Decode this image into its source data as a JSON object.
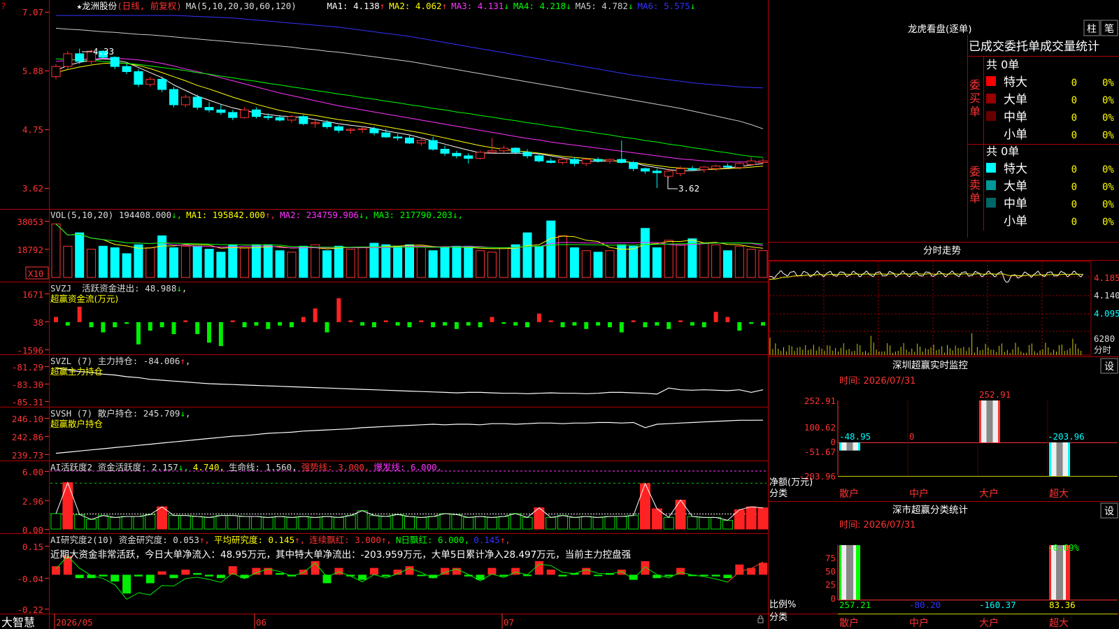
{
  "app": {
    "brand": "大智慧"
  },
  "main_chart": {
    "star": "★",
    "stock_name": "龙洲股份",
    "period": "(日线, 前复权)",
    "ma_params": "MA(5,10,20,30,60,120)",
    "ma_items": [
      {
        "label": "MA1: 4.138",
        "arrow": "↑",
        "color": "#ffffff"
      },
      {
        "label": "MA2: 4.062",
        "arrow": "↑",
        "color": "#ffff00"
      },
      {
        "label": "MA3: 4.131",
        "arrow": "↓",
        "color": "#ff33ff"
      },
      {
        "label": "MA4: 4.218",
        "arrow": "↓",
        "color": "#00ff00"
      },
      {
        "label": "MA5: 4.782",
        "arrow": "↓",
        "color": "#cccccc"
      },
      {
        "label": "MA6: 5.575",
        "arrow": "↓",
        "color": "#3333ff"
      }
    ],
    "y_ticks": [
      "7.07",
      "5.88",
      "4.75",
      "3.62"
    ],
    "high_label": "4.33",
    "low_label": "3.62"
  },
  "vol_panel": {
    "header": [
      {
        "text": "VOL(5,10,20) 194408.000",
        "arrow": "↓",
        "color": "#dddddd"
      },
      {
        "text": "MA1: 195842.000",
        "arrow": "↑",
        "color": "#ffff00"
      },
      {
        "text": "MA2: 234759.906",
        "arrow": "↓",
        "color": "#ff33ff"
      },
      {
        "text": "MA3: 217790.203",
        "arrow": "↓",
        "color": "#00ff00"
      }
    ],
    "y_ticks": [
      "38053",
      "18792"
    ],
    "unit": "X10"
  },
  "svzj_panel": {
    "title": "SVZJ  活跃资金进出: 48.988",
    "arrow": "↓",
    "subtitle": "超赢资金流(万元)",
    "y_ticks": [
      "1671",
      "38",
      "-1596"
    ]
  },
  "svzl_panel": {
    "title": "SVZL (7) 主力持仓: -84.006",
    "arrow": "↑",
    "subtitle": "超赢主力持仓",
    "y_ticks": [
      "-81.29",
      "-83.30",
      "-85.31"
    ]
  },
  "svsh_panel": {
    "title": "SVSH (7) 散户持仓: 245.709",
    "arrow": "↓",
    "subtitle": "超赢散户持仓",
    "y_ticks": [
      "246.10",
      "242.86",
      "239.73"
    ]
  },
  "ai_active_panel": {
    "header": [
      {
        "text": "AI活跃度2 资金活跃度: 2.157",
        "arrow": "↓",
        "color": "#dddddd"
      },
      {
        "text": "4.740,",
        "arrow": "",
        "color": "#ffff00"
      },
      {
        "text": "生命线: 1.560,",
        "arrow": "",
        "color": "#dddddd"
      },
      {
        "text": "强势线: 3.000,",
        "arrow": "",
        "color": "#ff3333"
      },
      {
        "text": "爆发线: 6.000,",
        "arrow": "",
        "color": "#ff33ff"
      }
    ],
    "y_ticks": [
      "6.00",
      "2.96",
      "0.00"
    ]
  },
  "ai_research_panel": {
    "header": [
      {
        "text": "AI研究度2(10) 资金研究度: 0.053",
        "arrow": "↑",
        "color": "#dddddd"
      },
      {
        "text": "平均研究度: 0.145",
        "arrow": "↑",
        "color": "#ffff00"
      },
      {
        "text": "连续飘红: 3.000",
        "arrow": "↑",
        "color": "#ff3333"
      },
      {
        "text": "N日飘红: 6.000,",
        "arrow": "",
        "color": "#00ff00"
      },
      {
        "text": "0.145",
        "arrow": "↑",
        "color": "#3333ff"
      }
    ],
    "note": "近期大资金非常活跃，今日大单净流入：48.95万元，其中特大单净流出：-203.959万元，大单5日累计净入28.497万元，当前主力控盘强",
    "y_ticks": [
      "0.15",
      "-0.04",
      "-0.22"
    ]
  },
  "x_axis": {
    "labels": [
      "2026/05",
      "06",
      "07"
    ]
  },
  "right_panel": {
    "dragon_tiger": "龙虎看盘(逐单)",
    "btn_zhu": "柱",
    "btn_bi": "笔",
    "stat_title": "已成交委托单成交量统计",
    "buy_label": "委买单",
    "sell_label": "委卖单",
    "buy_total": "共 0单",
    "sell_total": "共 0单",
    "buy_rows": [
      {
        "name": "特大",
        "count": "0",
        "pct": "0%",
        "color": "#ff0000"
      },
      {
        "name": "大单",
        "count": "0",
        "pct": "0%",
        "color": "#990000"
      },
      {
        "name": "中单",
        "count": "0",
        "pct": "0%",
        "color": "#660000"
      },
      {
        "name": "小单",
        "count": "0",
        "pct": "0%",
        "color": ""
      }
    ],
    "sell_rows": [
      {
        "name": "特大",
        "count": "0",
        "pct": "0%",
        "color": "#00ffff"
      },
      {
        "name": "大单",
        "count": "0",
        "pct": "0%",
        "color": "#009999"
      },
      {
        "name": "中单",
        "count": "0",
        "pct": "0%",
        "color": "#006666"
      },
      {
        "name": "小单",
        "count": "0",
        "pct": "0%",
        "color": ""
      }
    ],
    "intraday_title": "分时走势",
    "intraday_ticks": [
      "4.185",
      "4.140",
      "4.095"
    ],
    "intraday_vol": "6280",
    "intraday_vol_label": "分时"
  },
  "sz_monitor": {
    "title": "深圳超赢实时监控",
    "settings": "设",
    "time": "时间: 2026/07/31",
    "y_ticks": [
      "252.91",
      "100.62",
      "0",
      "-51.67",
      "-203.96"
    ],
    "bar_labels": [
      "-48.95",
      "0",
      "252.91",
      "-203.96"
    ],
    "ylabel": "净额(万元)",
    "category_label": "分类",
    "categories": [
      "散户",
      "中户",
      "大户",
      "超大"
    ]
  },
  "sz_classify": {
    "title": "深市超赢分类统计",
    "settings": "设",
    "time": "时间: 2026/07/31",
    "y_ticks": [
      "75",
      "50",
      "25",
      "0"
    ],
    "top_label": "-0.09%",
    "values": [
      "257.21",
      "-80.20",
      "-160.37",
      "83.36"
    ],
    "ylabel": "比例%",
    "category_label": "分类",
    "categories": [
      "散户",
      "中户",
      "大户",
      "超大"
    ]
  },
  "chart_data": {
    "type": "candlestick",
    "candles": [
      [
        5.8,
        6.05,
        5.75,
        6.0
      ],
      [
        6.0,
        6.3,
        5.95,
        6.25
      ],
      [
        6.25,
        6.35,
        6.05,
        6.1
      ],
      [
        6.1,
        6.33,
        6.05,
        6.3
      ],
      [
        6.3,
        6.32,
        6.15,
        6.18
      ],
      [
        6.18,
        6.2,
        5.95,
        6.0
      ],
      [
        6.0,
        6.05,
        5.85,
        5.9
      ],
      [
        5.9,
        5.95,
        5.6,
        5.65
      ],
      [
        5.65,
        5.8,
        5.6,
        5.75
      ],
      [
        5.75,
        5.8,
        5.5,
        5.55
      ],
      [
        5.55,
        5.6,
        5.2,
        5.25
      ],
      [
        5.25,
        5.45,
        5.2,
        5.4
      ],
      [
        5.4,
        5.45,
        5.15,
        5.2
      ],
      [
        5.2,
        5.3,
        5.1,
        5.15
      ],
      [
        5.15,
        5.25,
        5.05,
        5.1
      ],
      [
        5.1,
        5.15,
        4.95,
        5.0
      ],
      [
        5.0,
        5.2,
        4.98,
        5.15
      ],
      [
        5.15,
        5.2,
        4.98,
        5.02
      ],
      [
        5.02,
        5.08,
        4.95,
        5.0
      ],
      [
        5.0,
        5.05,
        4.92,
        4.95
      ],
      [
        4.95,
        5.05,
        4.9,
        5.02
      ],
      [
        5.02,
        5.05,
        4.85,
        4.88
      ],
      [
        4.88,
        4.95,
        4.8,
        4.9
      ],
      [
        4.9,
        4.95,
        4.78,
        4.82
      ],
      [
        4.82,
        4.85,
        4.7,
        4.75
      ],
      [
        4.75,
        4.8,
        4.68,
        4.77
      ],
      [
        4.77,
        4.82,
        4.7,
        4.78
      ],
      [
        4.78,
        4.82,
        4.65,
        4.7
      ],
      [
        4.7,
        4.78,
        4.6,
        4.62
      ],
      [
        4.62,
        4.68,
        4.55,
        4.6
      ],
      [
        4.6,
        4.65,
        4.48,
        4.5
      ],
      [
        4.5,
        4.6,
        4.45,
        4.55
      ],
      [
        4.55,
        4.62,
        4.35,
        4.38
      ],
      [
        4.38,
        4.45,
        4.25,
        4.3
      ],
      [
        4.3,
        4.35,
        4.2,
        4.25
      ],
      [
        4.25,
        4.3,
        4.1,
        4.2
      ],
      [
        4.2,
        4.35,
        4.18,
        4.32
      ],
      [
        4.32,
        4.6,
        4.3,
        4.35
      ],
      [
        4.35,
        4.45,
        4.3,
        4.4
      ],
      [
        4.4,
        4.42,
        4.28,
        4.32
      ],
      [
        4.32,
        4.38,
        4.2,
        4.25
      ],
      [
        4.25,
        4.3,
        4.12,
        4.15
      ],
      [
        4.15,
        4.2,
        4.1,
        4.12
      ],
      [
        4.12,
        4.2,
        4.08,
        4.18
      ],
      [
        4.18,
        4.22,
        4.05,
        4.1
      ],
      [
        4.1,
        4.2,
        4.05,
        4.18
      ],
      [
        4.18,
        4.22,
        4.12,
        4.15
      ],
      [
        4.15,
        4.2,
        4.1,
        4.18
      ],
      [
        4.18,
        4.55,
        4.1,
        4.12
      ],
      [
        4.12,
        4.15,
        3.95,
        4.0
      ],
      [
        4.0,
        4.02,
        3.9,
        3.95
      ],
      [
        3.95,
        4.0,
        3.62,
        3.92
      ],
      [
        3.85,
        4.0,
        3.82,
        3.95
      ],
      [
        3.9,
        4.05,
        3.85,
        4.0
      ],
      [
        4.0,
        4.05,
        3.95,
        3.98
      ],
      [
        3.98,
        4.05,
        3.92,
        4.03
      ],
      [
        4.0,
        4.08,
        3.95,
        4.05
      ],
      [
        4.05,
        4.1,
        4.0,
        4.03
      ],
      [
        4.02,
        4.12,
        3.98,
        4.1
      ],
      [
        4.08,
        4.22,
        4.05,
        4.15
      ],
      [
        4.12,
        4.2,
        4.08,
        4.15
      ]
    ],
    "ma_lines": {
      "MA5": [
        5.92,
        6.02,
        6.08,
        6.12,
        6.15,
        6.13,
        6.08,
        5.98,
        5.88,
        5.78,
        5.64,
        5.53,
        5.42,
        5.34,
        5.26,
        5.19,
        5.14,
        5.09,
        5.06,
        5.03,
        5.02,
        5.0,
        4.96,
        4.92,
        4.88,
        4.85,
        4.82,
        4.79,
        4.74,
        4.7,
        4.66,
        4.6,
        4.54,
        4.48,
        4.42,
        4.36,
        4.31,
        4.3,
        4.3,
        4.3,
        4.3,
        4.29,
        4.25,
        4.21,
        4.17,
        4.15,
        4.14,
        4.15,
        4.15,
        4.11,
        4.06,
        4.02,
        3.98,
        3.96,
        3.96,
        3.98,
        3.99,
        4.01,
        4.04,
        4.07,
        4.1
      ],
      "MA10": [
        5.88,
        5.94,
        5.99,
        6.03,
        6.06,
        6.07,
        6.06,
        6.02,
        5.96,
        5.88,
        5.8,
        5.72,
        5.63,
        5.56,
        5.48,
        5.4,
        5.33,
        5.26,
        5.2,
        5.14,
        5.1,
        5.07,
        5.04,
        5.0,
        4.96,
        4.93,
        4.9,
        4.86,
        4.82,
        4.78,
        4.74,
        4.7,
        4.65,
        4.6,
        4.55,
        4.5,
        4.45,
        4.41,
        4.38,
        4.35,
        4.33,
        4.3,
        4.27,
        4.24,
        4.22,
        4.2,
        4.18,
        4.16,
        4.14,
        4.12,
        4.09,
        4.06,
        4.03,
        4.01,
        4.0,
        3.99,
        3.99,
        4.0,
        4.01,
        4.03,
        4.05
      ],
      "MA20": [
        6.1,
        6.12,
        6.14,
        6.15,
        6.16,
        6.16,
        6.15,
        6.13,
        6.1,
        6.06,
        6.01,
        5.95,
        5.9,
        5.84,
        5.78,
        5.72,
        5.66,
        5.6,
        5.54,
        5.48,
        5.43,
        5.38,
        5.33,
        5.28,
        5.23,
        5.19,
        5.15,
        5.11,
        5.07,
        5.03,
        4.99,
        4.95,
        4.91,
        4.87,
        4.83,
        4.79,
        4.75,
        4.71,
        4.67,
        4.63,
        4.59,
        4.56,
        4.52,
        4.49,
        4.46,
        4.43,
        4.4,
        4.37,
        4.34,
        4.31,
        4.28,
        4.25,
        4.22,
        4.19,
        4.17,
        4.15,
        4.14,
        4.13,
        4.13,
        4.13,
        4.13
      ],
      "MA30": [
        6.15,
        6.14,
        6.13,
        6.12,
        6.1,
        6.08,
        6.06,
        6.04,
        6.01,
        5.98,
        5.95,
        5.92,
        5.88,
        5.85,
        5.81,
        5.78,
        5.74,
        5.71,
        5.67,
        5.64,
        5.6,
        5.57,
        5.53,
        5.5,
        5.46,
        5.43,
        5.39,
        5.36,
        5.32,
        5.29,
        5.25,
        5.22,
        5.18,
        5.15,
        5.11,
        5.08,
        5.04,
        5.01,
        4.97,
        4.94,
        4.9,
        4.87,
        4.83,
        4.8,
        4.76,
        4.73,
        4.69,
        4.66,
        4.62,
        4.59,
        4.55,
        4.52,
        4.48,
        4.45,
        4.41,
        4.38,
        4.34,
        4.31,
        4.27,
        4.24,
        4.22
      ],
      "MA60": [
        6.75,
        6.73,
        6.72,
        6.7,
        6.68,
        6.67,
        6.65,
        6.63,
        6.62,
        6.6,
        6.58,
        6.56,
        6.54,
        6.52,
        6.5,
        6.48,
        6.46,
        6.44,
        6.42,
        6.4,
        6.38,
        6.35,
        6.33,
        6.3,
        6.28,
        6.25,
        6.22,
        6.19,
        6.16,
        6.13,
        6.1,
        6.06,
        6.02,
        5.98,
        5.94,
        5.9,
        5.86,
        5.82,
        5.78,
        5.74,
        5.7,
        5.66,
        5.62,
        5.58,
        5.54,
        5.5,
        5.46,
        5.42,
        5.38,
        5.34,
        5.3,
        5.26,
        5.22,
        5.18,
        5.13,
        5.08,
        5.03,
        4.98,
        4.93,
        4.86,
        4.78
      ],
      "MA120": [
        7.0,
        7.0,
        7.0,
        7.0,
        7.0,
        7.0,
        7.0,
        7.0,
        7.0,
        7.0,
        7.0,
        6.99,
        6.98,
        6.97,
        6.96,
        6.95,
        6.93,
        6.91,
        6.89,
        6.87,
        6.85,
        6.83,
        6.81,
        6.79,
        6.77,
        6.74,
        6.71,
        6.68,
        6.65,
        6.62,
        6.59,
        6.55,
        6.51,
        6.47,
        6.43,
        6.39,
        6.35,
        6.31,
        6.27,
        6.23,
        6.19,
        6.15,
        6.11,
        6.07,
        6.03,
        5.99,
        5.95,
        5.91,
        5.87,
        5.83,
        5.8,
        5.77,
        5.74,
        5.71,
        5.68,
        5.66,
        5.64,
        5.62,
        5.6,
        5.59,
        5.58
      ]
    },
    "volume": [
      36000,
      21000,
      30000,
      19000,
      21000,
      20000,
      16000,
      22000,
      20000,
      28000,
      20000,
      21000,
      21000,
      19000,
      17000,
      22000,
      20000,
      22000,
      22000,
      18000,
      17000,
      21000,
      22000,
      18000,
      21000,
      19000,
      20000,
      23000,
      22000,
      21000,
      22000,
      21000,
      18000,
      20000,
      21000,
      21000,
      18000,
      17000,
      20000,
      22000,
      30000,
      21000,
      38000,
      28000,
      20000,
      18000,
      17000,
      18000,
      22000,
      21000,
      33000,
      20000,
      25000,
      22000,
      26000,
      23000,
      22000,
      18000,
      21000,
      19000,
      18000
    ],
    "svzj": [
      300,
      -200,
      900,
      -300,
      -600,
      -300,
      -100,
      -1300,
      -500,
      -300,
      -700,
      100,
      -700,
      -1200,
      -1400,
      100,
      -300,
      -200,
      -400,
      -200,
      -300,
      300,
      800,
      -600,
      1400,
      100,
      -200,
      -300,
      100,
      -200,
      -300,
      100,
      -300,
      -200,
      -400,
      -200,
      -300,
      300,
      -100,
      -200,
      -300,
      500,
      100,
      -300,
      -200,
      -400,
      -200,
      -300,
      -600,
      100,
      -300,
      -200,
      -400,
      100,
      -200,
      -300,
      600,
      300,
      -500,
      -100,
      -200
    ],
    "svzl": [
      -81.5,
      -81.7,
      -81.9,
      -82.0,
      -82.2,
      -82.3,
      -82.5,
      -82.6,
      -82.8,
      -82.9,
      -83.0,
      -83.1,
      -83.2,
      -83.3,
      -83.35,
      -83.4,
      -83.45,
      -83.5,
      -83.55,
      -83.6,
      -83.65,
      -83.7,
      -83.75,
      -83.8,
      -83.85,
      -83.9,
      -83.95,
      -84.0,
      -84.05,
      -84.1,
      -84.15,
      -84.2,
      -84.25,
      -84.3,
      -84.35,
      -84.3,
      -84.3,
      -84.35,
      -84.4,
      -84.4,
      -84.45,
      -84.4,
      -84.35,
      -84.4,
      -84.4,
      -84.45,
      -84.4,
      -84.3,
      -84.3,
      -84.35,
      -84.4,
      -84.5,
      -83.8,
      -84.0,
      -84.05,
      -84.0,
      -84.05,
      -84.1,
      -84.0,
      -84.3,
      -84.0
    ],
    "svsh": [
      239.9,
      240.1,
      240.3,
      240.5,
      240.7,
      240.9,
      241.1,
      241.3,
      241.5,
      241.7,
      241.9,
      242.1,
      242.3,
      242.5,
      242.7,
      242.9,
      243.0,
      243.2,
      243.4,
      243.5,
      243.6,
      243.8,
      243.9,
      244.0,
      244.1,
      244.2,
      244.4,
      244.5,
      244.6,
      244.7,
      244.8,
      244.9,
      245.0,
      244.9,
      245.0,
      245.0,
      244.9,
      245.1,
      245.1,
      245.0,
      245.1,
      245.2,
      245.2,
      245.1,
      245.2,
      245.2,
      245.3,
      245.3,
      245.2,
      245.3,
      244.4,
      245.0,
      245.1,
      245.2,
      245.3,
      245.4,
      245.5,
      245.6,
      245.7,
      245.7,
      245.71
    ],
    "ai_active": [
      1.6,
      4.8,
      1.5,
      1.0,
      1.4,
      1.2,
      1.3,
      1.3,
      1.5,
      2.3,
      1.4,
      1.4,
      1.3,
      1.2,
      1.4,
      1.4,
      1.3,
      1.3,
      1.2,
      1.3,
      1.2,
      1.3,
      1.2,
      1.3,
      1.2,
      1.4,
      1.9,
      1.4,
      1.3,
      1.5,
      1.3,
      1.2,
      1.3,
      1.6,
      1.5,
      1.2,
      1.3,
      1.2,
      1.3,
      1.6,
      1.2,
      2.2,
      1.2,
      1.4,
      1.2,
      1.3,
      1.2,
      1.3,
      1.3,
      1.4,
      4.7,
      2.1,
      1.2,
      3.0,
      1.3,
      1.2,
      1.2,
      0.9,
      2.0,
      2.3,
      2.2
    ],
    "ai_research": [
      0.03,
      0.09,
      -0.04,
      -0.04,
      -0.03,
      -0.06,
      -0.13,
      -0.03,
      -0.07,
      0.0,
      -0.04,
      0.01,
      -0.01,
      -0.03,
      -0.04,
      0.03,
      -0.04,
      0.02,
      0.02,
      -0.01,
      -0.03,
      0.01,
      0.06,
      -0.07,
      0.02,
      -0.03,
      -0.05,
      0.02,
      -0.03,
      0.01,
      0.03,
      -0.02,
      -0.04,
      0.02,
      0.02,
      -0.03,
      -0.05,
      0.02,
      -0.03,
      0.02,
      -0.02,
      0.06,
      0.01,
      -0.03,
      -0.01,
      0.02,
      -0.02,
      -0.01,
      0.01,
      -0.05,
      0.06,
      -0.04,
      -0.03,
      0.02,
      -0.02,
      -0.02,
      -0.03,
      -0.04,
      0.04,
      0.02,
      0.05
    ]
  }
}
